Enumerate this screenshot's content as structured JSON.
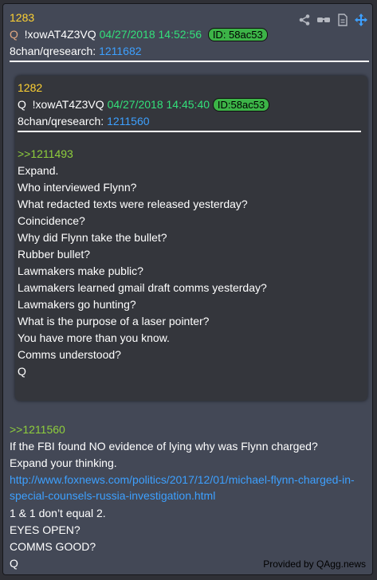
{
  "outer_post": {
    "number": "1283",
    "q_marker": "Q",
    "tripcode": "!xowAT4Z3VQ",
    "datetime": "04/27/2018 14:52:56",
    "id_badge": "ID: 58ac53",
    "board": "8chan/qresearch:",
    "post_link": "1211682",
    "reply_ref": ">>1211560",
    "lines": [
      "If the FBI found NO evidence of lying why was Flynn charged?",
      "Expand your thinking."
    ],
    "url_line1": "http://www.foxnews.com/politics/2017/12/01/michael-flynn-charged-in-",
    "url_line2": "special-counsels-russia-investigation.html",
    "lines_after": [
      "1 & 1 don’t equal 2.",
      "EYES OPEN?",
      "COMMS GOOD?",
      "Q"
    ]
  },
  "inner_post": {
    "number": "1282",
    "q_marker": "Q",
    "tripcode": "!xowAT4Z3VQ",
    "datetime": "04/27/2018 14:45:40",
    "id_badge": "ID:58ac53",
    "board": "8chan/qresearch:",
    "post_link": "1211560",
    "reply_ref": ">>1211493",
    "lines": [
      "Expand.",
      "Who interviewed Flynn?",
      "What redacted texts were released yesterday?",
      "Coincidence?",
      "Why did Flynn take the bullet?",
      "Rubber bullet?",
      "Lawmakers make public?",
      "Lawmakers learned gmail draft comms yesterday?",
      "Lawmakers go hunting?",
      "What is the purpose of a laser pointer?",
      "You have more than you know.",
      "Comms understood?",
      "Q"
    ]
  },
  "footer": "Provided by QAgg.news",
  "icons": [
    "share-icon",
    "glasses-icon",
    "document-icon",
    "move-icon"
  ],
  "colors": {
    "number": "#ffd233",
    "date": "#33e07a",
    "link": "#3da0ff",
    "greentext": "#8fcf3c",
    "badge": "#3cb347"
  }
}
